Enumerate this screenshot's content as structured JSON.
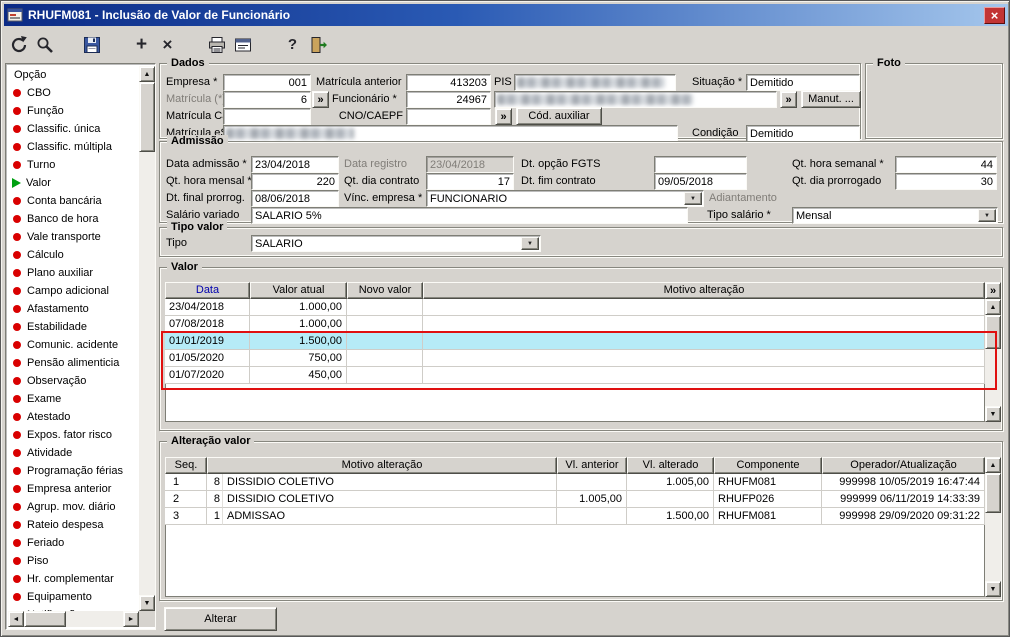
{
  "window": {
    "title": "RHUFM081 - Inclusão de Valor de Funcionário",
    "close_glyph": "×"
  },
  "toolbar": {
    "icons": [
      "undo",
      "search",
      "save",
      "add",
      "delete",
      "print",
      "print-form",
      "help",
      "exit"
    ],
    "add_glyph": "+",
    "delete_glyph": "×",
    "help_glyph": "?"
  },
  "sidebar": {
    "header": "Opção",
    "items": [
      {
        "label": "CBO",
        "bullet": "red"
      },
      {
        "label": "Função",
        "bullet": "red"
      },
      {
        "label": "Classific. única",
        "bullet": "red"
      },
      {
        "label": "Classific. múltipla",
        "bullet": "red"
      },
      {
        "label": "Turno",
        "bullet": "red"
      },
      {
        "label": "Valor",
        "bullet": "green"
      },
      {
        "label": "Conta bancária",
        "bullet": "red"
      },
      {
        "label": "Banco de hora",
        "bullet": "red"
      },
      {
        "label": "Vale transporte",
        "bullet": "red"
      },
      {
        "label": "Cálculo",
        "bullet": "red"
      },
      {
        "label": "Plano auxiliar",
        "bullet": "red"
      },
      {
        "label": "Campo adicional",
        "bullet": "red"
      },
      {
        "label": "Afastamento",
        "bullet": "red"
      },
      {
        "label": "Estabilidade",
        "bullet": "red"
      },
      {
        "label": "Comunic. acidente",
        "bullet": "red"
      },
      {
        "label": "Pensão alimenticia",
        "bullet": "red"
      },
      {
        "label": "Observação",
        "bullet": "red"
      },
      {
        "label": "Exame",
        "bullet": "red"
      },
      {
        "label": "Atestado",
        "bullet": "red"
      },
      {
        "label": "Expos. fator risco",
        "bullet": "red"
      },
      {
        "label": "Atividade",
        "bullet": "red"
      },
      {
        "label": "Programação férias",
        "bullet": "red"
      },
      {
        "label": "Empresa anterior",
        "bullet": "red"
      },
      {
        "label": "Agrup. mov. diário",
        "bullet": "red"
      },
      {
        "label": "Rateio despesa",
        "bullet": "red"
      },
      {
        "label": "Feriado",
        "bullet": "red"
      },
      {
        "label": "Piso",
        "bullet": "red"
      },
      {
        "label": "Hr. complementar",
        "bullet": "red"
      },
      {
        "label": "Equipamento",
        "bullet": "red"
      },
      {
        "label": "Notificação",
        "bullet": "red"
      }
    ]
  },
  "dados": {
    "title": "Dados",
    "empresa": {
      "label": "Empresa *",
      "value": "001"
    },
    "matricula_anterior": {
      "label": "Matrícula anterior",
      "value": "413203"
    },
    "pis": {
      "label": "PIS",
      "value": ""
    },
    "situacao": {
      "label": "Situação *",
      "value": "Demitido"
    },
    "matricula": {
      "label": "Matrícula (*)",
      "value": "6"
    },
    "funcionario": {
      "label": "Funcionário *",
      "value": "24967",
      "nome": ""
    },
    "manut_button": "Manut. ...",
    "matricula_caixa": {
      "label": "Matrícula Caixa",
      "value": ""
    },
    "cno_caepf": {
      "label": "CNO/CAEPF",
      "value": ""
    },
    "cod_auxiliar_button": "Cód. auxiliar",
    "matricula_esocial": {
      "label": "Matrícula eSocial",
      "value": ""
    },
    "condicao": {
      "label": "Condição",
      "value": "Demitido"
    },
    "lookup_button": "»"
  },
  "foto": {
    "title": "Foto"
  },
  "admissao": {
    "title": "Admissão",
    "data_admissao": {
      "label": "Data admissão *",
      "value": "23/04/2018"
    },
    "data_registro": {
      "label": "Data registro",
      "value": "23/04/2018"
    },
    "dt_opcao_fgts": {
      "label": "Dt. opção FGTS",
      "value": ""
    },
    "qt_hora_semanal": {
      "label": "Qt. hora semanal *",
      "value": "44"
    },
    "qt_hora_mensal": {
      "label": "Qt. hora mensal *",
      "value": "220"
    },
    "qt_dia_contrato": {
      "label": "Qt. dia contrato",
      "value": "17"
    },
    "dt_fim_contrato": {
      "label": "Dt. fim contrato",
      "value": "09/05/2018"
    },
    "qt_dia_prorrogado": {
      "label": "Qt. dia prorrogado",
      "value": "30"
    },
    "dt_final_prorrog": {
      "label": "Dt. final prorrog.",
      "value": "08/06/2018"
    },
    "vinc_empresa": {
      "label": "Vínc. empresa *",
      "value": "FUNCIONARIO"
    },
    "adiantamento_label": "Adiantamento",
    "salario_variado": {
      "label": "Salário variado",
      "value": "SALARIO 5%"
    },
    "tipo_salario": {
      "label": "Tipo salário *",
      "value": "Mensal"
    }
  },
  "tipo_valor": {
    "title": "Tipo valor",
    "tipo": {
      "label": "Tipo",
      "value": "SALARIO"
    }
  },
  "valor": {
    "title": "Valor",
    "more_button": "»",
    "columns": [
      {
        "label": "Data",
        "state": "sorted"
      },
      {
        "label": "Valor atual",
        "state": ""
      },
      {
        "label": "Novo valor",
        "state": ""
      },
      {
        "label": "Motivo alteração",
        "state": ""
      }
    ],
    "rows": [
      {
        "data": "23/04/2018",
        "valor_atual": "1.000,00",
        "novo_valor": "",
        "motivo": "",
        "state": ""
      },
      {
        "data": "07/08/2018",
        "valor_atual": "1.000,00",
        "novo_valor": "",
        "motivo": "",
        "state": ""
      },
      {
        "data": "01/01/2019",
        "valor_atual": "1.500,00",
        "novo_valor": "",
        "motivo": "",
        "state": "selected"
      },
      {
        "data": "01/05/2020",
        "valor_atual": "750,00",
        "novo_valor": "",
        "motivo": "",
        "state": ""
      },
      {
        "data": "01/07/2020",
        "valor_atual": "450,00",
        "novo_valor": "",
        "motivo": "",
        "state": ""
      }
    ]
  },
  "alteracao_valor": {
    "title": "Alteração valor",
    "columns": [
      "Seq.",
      "Motivo alteração",
      "Vl. anterior",
      "Vl. alterado",
      "Componente",
      "Operador/Atualização"
    ],
    "rows": [
      {
        "seq": "1",
        "codigo": "8",
        "motivo": "DISSIDIO COLETIVO",
        "vl_anterior": "",
        "vl_alterado": "1.005,00",
        "componente": "RHUFM081",
        "operador": "999998 10/05/2019 16:47:44",
        "state": ""
      },
      {
        "seq": "2",
        "codigo": "8",
        "motivo": "DISSIDIO COLETIVO",
        "vl_anterior": "1.005,00",
        "vl_alterado": "",
        "componente": "RHUFP026",
        "operador": "999999 06/11/2019 14:33:39",
        "state": ""
      },
      {
        "seq": "3",
        "codigo": "1",
        "motivo": "ADMISSAO",
        "vl_anterior": "",
        "vl_alterado": "1.500,00",
        "componente": "RHUFM081",
        "operador": "999998 29/09/2020 09:31:22",
        "state": ""
      }
    ]
  },
  "footer": {
    "alterar_button": "Alterar"
  },
  "colors": {
    "window_bg": "#d6d3ce",
    "titlebar_start": "#0b2a85",
    "titlebar_end": "#a4c6ec",
    "selected_row": "#b6ebf7",
    "annotation_box": "#e01010",
    "bullet_red": "#d90000",
    "bullet_green": "#00a012",
    "sorted_header_text": "#0000ae"
  }
}
